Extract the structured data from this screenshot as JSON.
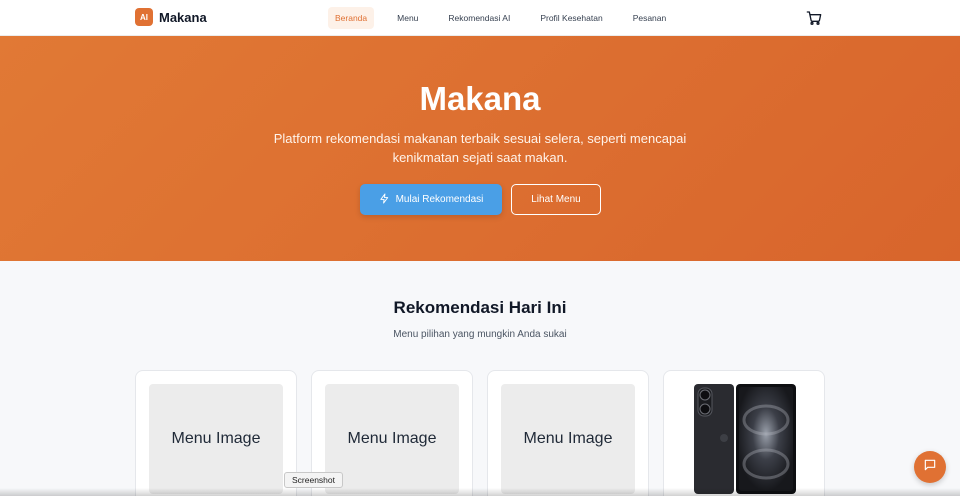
{
  "brand": {
    "logo_text": "AI",
    "name": "Makana"
  },
  "nav": {
    "items": [
      {
        "label": "Beranda",
        "active": true
      },
      {
        "label": "Menu",
        "active": false
      },
      {
        "label": "Rekomendasi AI",
        "active": false
      },
      {
        "label": "Profil Kesehatan",
        "active": false
      },
      {
        "label": "Pesanan",
        "active": false
      }
    ],
    "cart_icon": "shopping-cart-icon"
  },
  "hero": {
    "title": "Makana",
    "subtitle_line1": "Platform rekomendasi makanan terbaik sesuai selera, seperti mencapai",
    "subtitle_line2": "kenikmatan sejati saat makan.",
    "primary_button": "Mulai Rekomendasi",
    "primary_icon": "lightning-icon",
    "secondary_button": "Lihat Menu",
    "gradient_start": "#e17935",
    "gradient_end": "#d8652c"
  },
  "recommendations": {
    "title": "Rekomendasi Hari Ini",
    "subtitle": "Menu pilihan yang mungkin Anda sukai",
    "cards": [
      {
        "image_label": "Menu Image"
      },
      {
        "image_label": "Menu Image"
      },
      {
        "image_label": "Menu Image"
      },
      {
        "image_label": "",
        "image_type": "smartphone-photo"
      }
    ]
  },
  "tooltip": {
    "text": "Screenshot"
  },
  "chat_button": {
    "icon": "chat-bubble-icon"
  },
  "colors": {
    "accent": "#e07133",
    "primary_button": "#4a9fe6"
  }
}
